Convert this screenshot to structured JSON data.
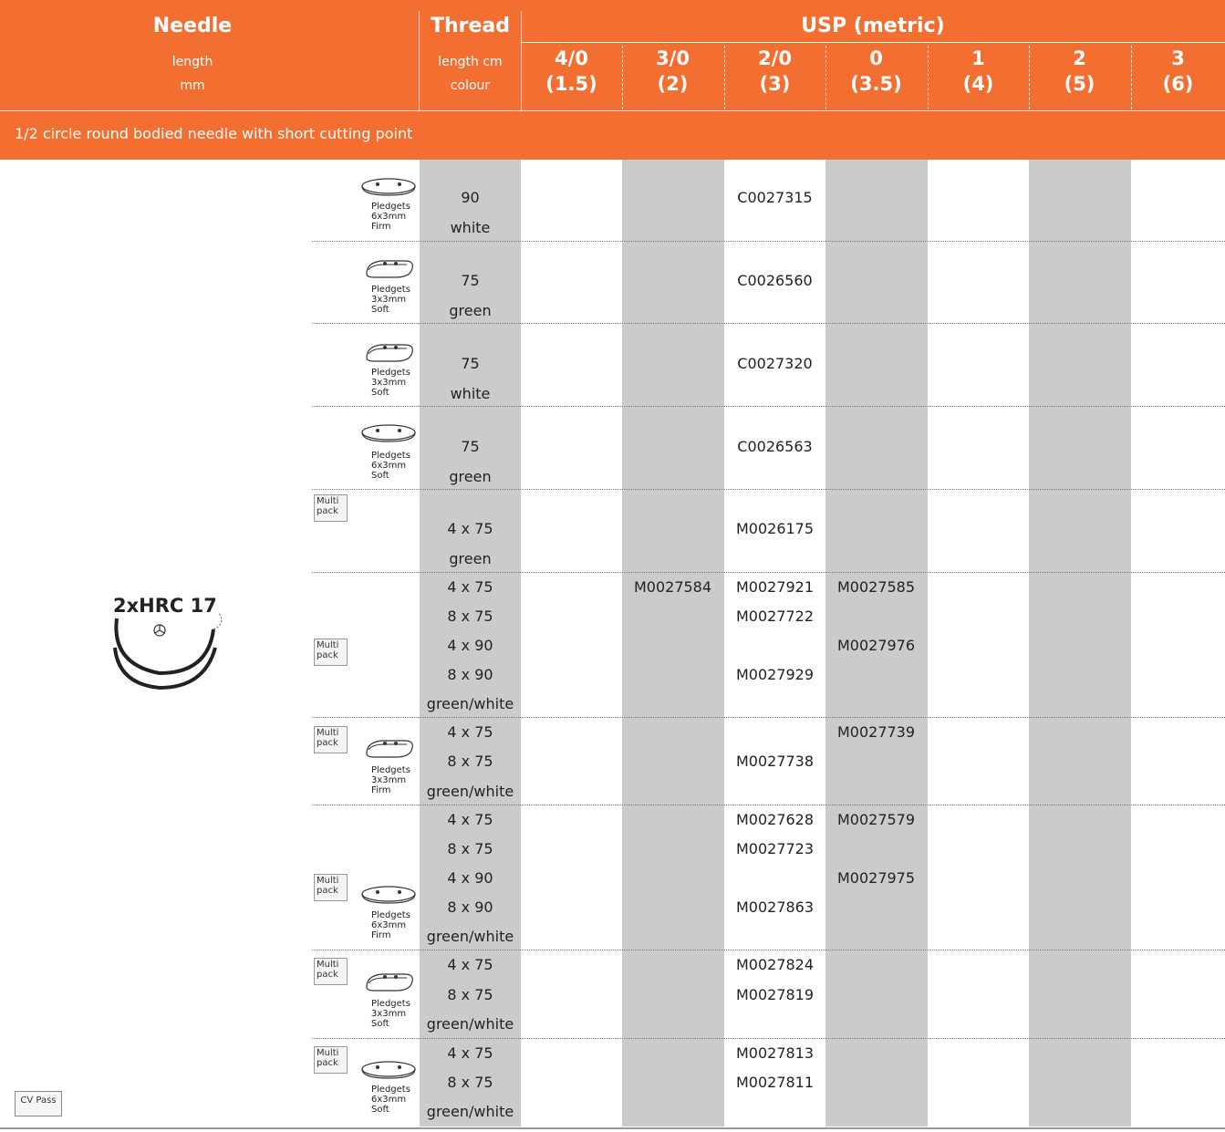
{
  "header": {
    "needle_title": "Needle",
    "needle_sub1": "length",
    "needle_sub2": "mm",
    "thread_title": "Thread",
    "thread_sub1": "length cm",
    "thread_sub2": "colour",
    "usp_title": "USP (metric)",
    "sizes": [
      {
        "usp": "4/0",
        "metric": "(1.5)"
      },
      {
        "usp": "3/0",
        "metric": "(2)"
      },
      {
        "usp": "2/0",
        "metric": "(3)"
      },
      {
        "usp": "0",
        "metric": "(3.5)"
      },
      {
        "usp": "1",
        "metric": "(4)"
      },
      {
        "usp": "2",
        "metric": "(5)"
      },
      {
        "usp": "3",
        "metric": "(6)"
      }
    ]
  },
  "section_title": "1/2 circle round bodied needle with short cutting point",
  "needle_label": "2xHRC 17",
  "multipack_label": [
    "Multi",
    "pack"
  ],
  "cvpass_label": "CV Pass",
  "pledget_labels": {
    "p1": [
      "Pledgets",
      "6x3mm",
      "Firm"
    ],
    "p2": [
      "Pledgets",
      "3x3mm",
      "Soft"
    ],
    "p3": [
      "Pledgets",
      "3x3mm",
      "Soft"
    ],
    "p4": [
      "Pledgets",
      "6x3mm",
      "Soft"
    ],
    "p7": [
      "Pledgets",
      "3x3mm",
      "Firm"
    ],
    "p8": [
      "Pledgets",
      "6x3mm",
      "Firm"
    ],
    "p9": [
      "Pledgets",
      "3x3mm",
      "Soft"
    ],
    "p10": [
      "Pledgets",
      "6x3mm",
      "Soft"
    ]
  },
  "rows": {
    "r1": {
      "thread": [
        "90",
        "white"
      ],
      "code_20": "C0027315"
    },
    "r2": {
      "thread": [
        "75",
        "green"
      ],
      "code_20": "C0026560"
    },
    "r3": {
      "thread": [
        "75",
        "white"
      ],
      "code_20": "C0027320"
    },
    "r4": {
      "thread": [
        "75",
        "green"
      ],
      "code_20": "C0026563"
    },
    "r5": {
      "thread": [
        "4 x 75",
        "green"
      ],
      "code_20": "M0026175"
    },
    "r6": {
      "thread": [
        "4 x 75",
        "8 x 75",
        "4 x 90",
        "8 x 90",
        "green/white"
      ],
      "c30": "M0027584",
      "c20a": "M0027921",
      "c20b": "M0027722",
      "c20d": "M0027929",
      "c0a": "M0027585",
      "c0c": "M0027976"
    },
    "r7": {
      "thread": [
        "4 x 75",
        "8 x 75",
        "green/white"
      ],
      "c0a": "M0027739",
      "c20b": "M0027738"
    },
    "r8": {
      "thread": [
        "4 x 75",
        "8 x 75",
        "4 x 90",
        "8 x 90",
        "green/white"
      ],
      "c20a": "M0027628",
      "c20b": "M0027723",
      "c20d": "M0027863",
      "c0a": "M0027579",
      "c0c": "M0027975"
    },
    "r9": {
      "thread": [
        "4 x 75",
        "8 x 75",
        "green/white"
      ],
      "c20a": "M0027824",
      "c20b": "M0027819"
    },
    "r10": {
      "thread": [
        "4 x 75",
        "8 x 75",
        "green/white"
      ],
      "c20a": "M0027813",
      "c20b": "M0027811"
    }
  }
}
